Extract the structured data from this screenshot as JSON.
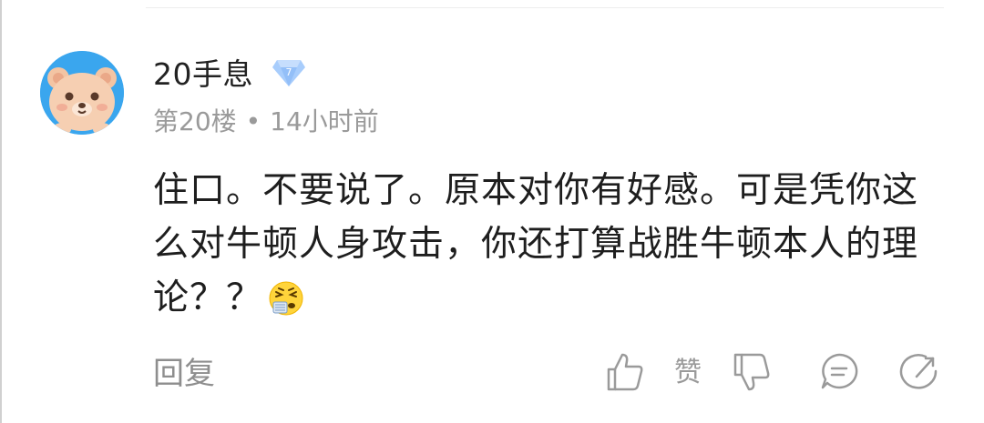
{
  "comment": {
    "username": "20手息",
    "level_badge": "7",
    "floor": "第20楼",
    "separator": "•",
    "time": "14小时前",
    "body": "住口。不要说了。原本对你有好感。可是凭你这么对牛顿人身攻击，你还打算战胜牛顿本人的理论？？",
    "emoji_icon": "sneezing-face-emoji-icon"
  },
  "actions": {
    "reply_label": "回复",
    "like_label": "赞",
    "like_icon": "thumbs-up-icon",
    "dislike_icon": "thumbs-down-icon",
    "comment_icon": "comment-bubble-icon",
    "share_icon": "share-icon"
  },
  "colors": {
    "avatar_bg": "#3aa6ee",
    "badge": "#a8cdfc",
    "text_primary": "#1e1e1e",
    "text_secondary": "#9a9a9a"
  }
}
